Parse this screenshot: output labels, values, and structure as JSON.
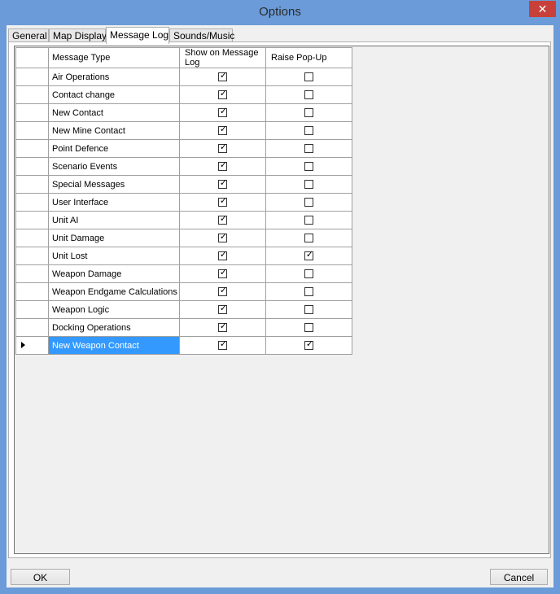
{
  "window": {
    "title": "Options",
    "close_glyph": "✕"
  },
  "tabs": [
    {
      "label": "General",
      "active": false
    },
    {
      "label": "Map Display",
      "active": false
    },
    {
      "label": "Message Log",
      "active": true
    },
    {
      "label": "Sounds/Music",
      "active": false
    }
  ],
  "grid": {
    "columns": {
      "type": "Message Type",
      "show": "Show on Message Log",
      "raise": "Raise Pop-Up"
    },
    "rows": [
      {
        "type": "Air Operations",
        "show": true,
        "raise": false
      },
      {
        "type": "Contact change",
        "show": true,
        "raise": false
      },
      {
        "type": "New Contact",
        "show": true,
        "raise": false
      },
      {
        "type": "New Mine Contact",
        "show": true,
        "raise": false
      },
      {
        "type": "Point Defence",
        "show": true,
        "raise": false
      },
      {
        "type": "Scenario Events",
        "show": true,
        "raise": false
      },
      {
        "type": "Special Messages",
        "show": true,
        "raise": false
      },
      {
        "type": "User Interface",
        "show": true,
        "raise": false
      },
      {
        "type": "Unit AI",
        "show": true,
        "raise": false
      },
      {
        "type": "Unit Damage",
        "show": true,
        "raise": false
      },
      {
        "type": "Unit Lost",
        "show": true,
        "raise": true
      },
      {
        "type": "Weapon Damage",
        "show": true,
        "raise": false
      },
      {
        "type": "Weapon Endgame Calculations",
        "show": true,
        "raise": false
      },
      {
        "type": "Weapon Logic",
        "show": true,
        "raise": false
      },
      {
        "type": "Docking Operations",
        "show": true,
        "raise": false
      },
      {
        "type": "New Weapon Contact",
        "show": true,
        "raise": true,
        "selected": true
      }
    ]
  },
  "buttons": {
    "ok": "OK",
    "cancel": "Cancel"
  },
  "colors": {
    "titlebar": "#6b9bd8",
    "close": "#c7413a",
    "selection": "#3399ff"
  }
}
